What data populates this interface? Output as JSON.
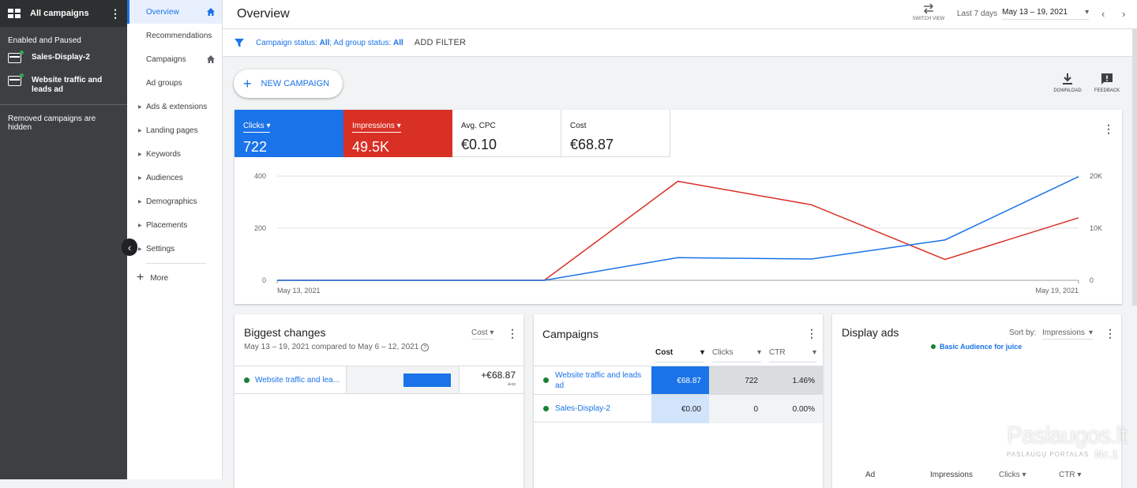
{
  "left_panel": {
    "title": "All campaigns",
    "filter_label": "Enabled and Paused",
    "campaigns": [
      {
        "name": "Sales-Display-2"
      },
      {
        "name": "Website traffic and leads ad"
      }
    ],
    "removed_note": "Removed campaigns are hidden"
  },
  "nav": {
    "items": [
      {
        "label": "Overview"
      },
      {
        "label": "Recommendations"
      },
      {
        "label": "Campaigns"
      },
      {
        "label": "Ad groups"
      },
      {
        "label": "Ads & extensions"
      },
      {
        "label": "Landing pages"
      },
      {
        "label": "Keywords"
      },
      {
        "label": "Audiences"
      },
      {
        "label": "Demographics"
      },
      {
        "label": "Placements"
      },
      {
        "label": "Settings"
      }
    ],
    "more": "More"
  },
  "header": {
    "title": "Overview",
    "switch_view": "SWITCH VIEW",
    "date_label": "Last 7 days",
    "date_range": "May 13 – 19, 2021"
  },
  "filter_bar": {
    "campaign_status_label": "Campaign status:",
    "campaign_status_value": "All",
    "ad_group_status_label": "; Ad group status:",
    "ad_group_status_value": "All",
    "add_filter": "ADD FILTER"
  },
  "toolbar": {
    "new_campaign": "NEW CAMPAIGN",
    "download": "DOWNLOAD",
    "feedback": "FEEDBACK"
  },
  "metrics": [
    {
      "label": "Clicks",
      "value": "722"
    },
    {
      "label": "Impressions",
      "value": "49.5K"
    },
    {
      "label": "Avg. CPC",
      "value": "€0.10"
    },
    {
      "label": "Cost",
      "value": "€68.87"
    }
  ],
  "colors": {
    "blue": "#1a73e8",
    "red": "#d93025",
    "green": "#188038"
  },
  "chart_data": {
    "type": "line",
    "x": [
      "May 13, 2021",
      "May 14, 2021",
      "May 15, 2021",
      "May 16, 2021",
      "May 17, 2021",
      "May 18, 2021",
      "May 19, 2021"
    ],
    "x_tick_labels": [
      "May 13, 2021",
      "May 19, 2021"
    ],
    "y_left_ticks": [
      "0",
      "200",
      "400"
    ],
    "y_right_ticks": [
      "0",
      "10K",
      "20K"
    ],
    "y_left_lim": [
      0,
      400
    ],
    "y_right_lim": [
      0,
      20000
    ],
    "grid": true,
    "series": [
      {
        "name": "Clicks",
        "axis": "left",
        "color": "#1a73e8",
        "values": [
          0,
          0,
          0,
          87,
          82,
          155,
          398
        ]
      },
      {
        "name": "Impressions",
        "axis": "right",
        "color": "#d93025",
        "values": [
          0,
          0,
          0,
          19000,
          14500,
          4000,
          12000
        ]
      }
    ]
  },
  "biggest_changes": {
    "title": "Biggest changes",
    "subtitle": "May 13 – 19, 2021 compared to May 6 – 12, 2021",
    "metric_select": "Cost",
    "row": {
      "name": "Website traffic and lea...",
      "value": "+€68.87",
      "sub": "+∞",
      "bar_fraction": 1.0
    }
  },
  "campaigns_card": {
    "title": "Campaigns",
    "columns": [
      "Cost",
      "Clicks",
      "CTR"
    ],
    "rows": [
      {
        "name": "Website traffic and leads ad",
        "cost": "€68.87",
        "clicks": "722",
        "ctr": "1.46%"
      },
      {
        "name": "Sales-Display-2",
        "cost": "€0.00",
        "clicks": "0",
        "ctr": "0.00%"
      }
    ]
  },
  "display_ads": {
    "title": "Display ads",
    "sort_label": "Sort by:",
    "sort_value": "Impressions",
    "audience": "Basic Audience for juice",
    "footer": [
      "Ad",
      "Impressions",
      "Clicks",
      "CTR"
    ]
  },
  "watermark": {
    "name": "Paslaugos.lt",
    "tagline": "PASLAUGŲ PORTALAS",
    "badge": "Nr.1"
  }
}
